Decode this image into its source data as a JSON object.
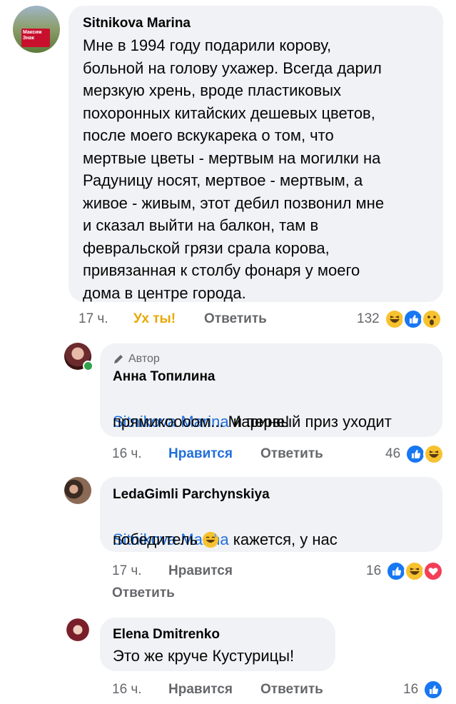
{
  "comments": [
    {
      "author": "Sitnikova Marina",
      "text": "Мне в 1994 году подарили корову,\nбольной на голову ухажер. Всегда дарил\nмерзкую хрень, вроде пластиковых\nпохоронных китайских дешевых цветов,\nпосле моего вскукарека о том, что\nмертвые цветы - мертвым на могилки на\nРадуницу носят, мертвое - мертвым, а\nживое - живым, этот дебил позвонил мне\nи сказал выйти на балкон, там в\nфевральской грязи срала корова,\nпривязанная к столбу фонаря у моего\nдома в центре города.",
      "time": "17 ч.",
      "reaction_label": "Ух ты!",
      "reply_label": "Ответить",
      "reaction_count": "132",
      "reaction_icons": [
        "haha-icon",
        "like-icon",
        "wow-icon"
      ],
      "avatar_text": "Максим Знак"
    },
    {
      "badge": "Автор",
      "author": "Анна Топилина",
      "mention": "Sitnikova Marina",
      "text_after_mention": " и первый приз уходит",
      "text_line2": "прямикоооом... Марине!",
      "time": "16 ч.",
      "reaction_label": "Нравится",
      "reply_label": "Ответить",
      "reaction_count": "46",
      "reaction_icons": [
        "like-icon",
        "haha-icon"
      ]
    },
    {
      "author": "LedaGimli Parchynskiya",
      "mention": "Sitnikova Marina",
      "text_after_mention": " кажется, у нас",
      "text_line2": "победитель",
      "time": "17 ч.",
      "reaction_label": "Нравится",
      "reply_label": "Ответить",
      "reaction_count": "16",
      "reaction_icons": [
        "like-icon",
        "haha-icon",
        "love-icon"
      ]
    },
    {
      "author": "Elena Dmitrenko",
      "text": "Это же круче Кустурицы!",
      "time": "16 ч.",
      "reaction_label": "Нравится",
      "reply_label": "Ответить",
      "reaction_count": "16",
      "reaction_icons": [
        "like-icon"
      ]
    }
  ],
  "colors": {
    "bubble": "#f0f2f5",
    "mention": "#216fdb",
    "meta": "#65676b",
    "like_active": "#216fdb",
    "wow_active": "#e8a800"
  }
}
